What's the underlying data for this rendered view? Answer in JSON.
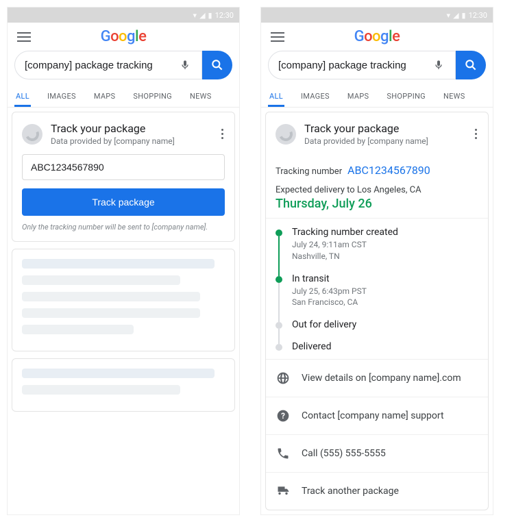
{
  "status_time": "12:30",
  "logo_letters": [
    "G",
    "o",
    "o",
    "g",
    "l",
    "e"
  ],
  "search_query": "[company] package tracking",
  "tabs": [
    "ALL",
    "IMAGES",
    "MAPS",
    "SHOPPING",
    "NEWS"
  ],
  "card": {
    "title": "Track your package",
    "subtitle": "Data provided by [company name]"
  },
  "input_panel": {
    "value": "ABC1234567890",
    "button": "Track package",
    "note": "Only the tracking number will be sent to [company name]."
  },
  "result": {
    "tracking_label": "Tracking number",
    "tracking_number": "ABC1234567890",
    "expected_label": "Expected delivery to Los Angeles, CA",
    "expected_date": "Thursday, July 26",
    "steps": [
      {
        "title": "Tracking number created",
        "detail": "July 24, 9:11am CST\nNashville, TN",
        "done": true,
        "line": true
      },
      {
        "title": "In transit",
        "detail": "July 25, 6:43pm PST\nSan Francisco, CA",
        "done": true,
        "line": false
      },
      {
        "title": "Out for delivery",
        "detail": "",
        "done": false,
        "line": false
      },
      {
        "title": "Delivered",
        "detail": "",
        "done": false,
        "line": false
      }
    ],
    "links": [
      {
        "icon": "globe",
        "label": "View details on [company name].com"
      },
      {
        "icon": "help",
        "label": "Contact [company name] support"
      },
      {
        "icon": "phone",
        "label": "Call (555) 555-5555"
      },
      {
        "icon": "truck",
        "label": "Track another package"
      }
    ]
  }
}
